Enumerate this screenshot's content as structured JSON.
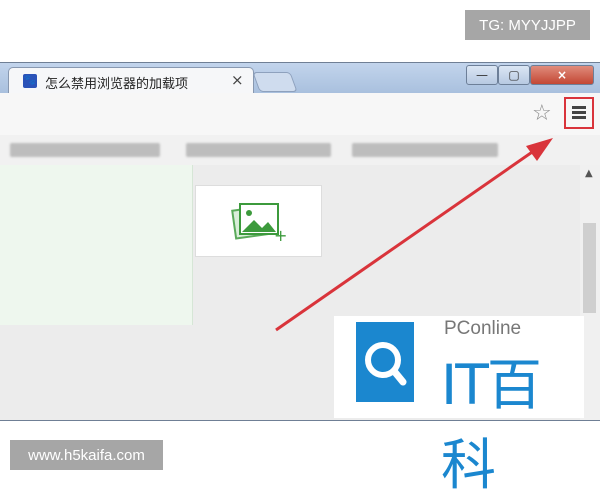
{
  "overlay": {
    "top_watermark": "TG: MYYJJPP",
    "bottom_watermark": "www.h5kaifa.com"
  },
  "browser": {
    "tab": {
      "title": "怎么禁用浏览器的加载项",
      "favicon": "baidu-paw-icon",
      "close_glyph": "×"
    },
    "window_controls": {
      "minimize_glyph": "—",
      "maximize_glyph": "▢",
      "close_glyph": "×"
    },
    "toolbar": {
      "bookmark_star_glyph": "☆",
      "menu_icon": "hamburger-menu-icon"
    }
  },
  "annotation": {
    "color": "#d9343b",
    "target": "menu-button"
  },
  "logo": {
    "brand": "PConline",
    "name": "IT百科",
    "color": "#1b87cf"
  }
}
